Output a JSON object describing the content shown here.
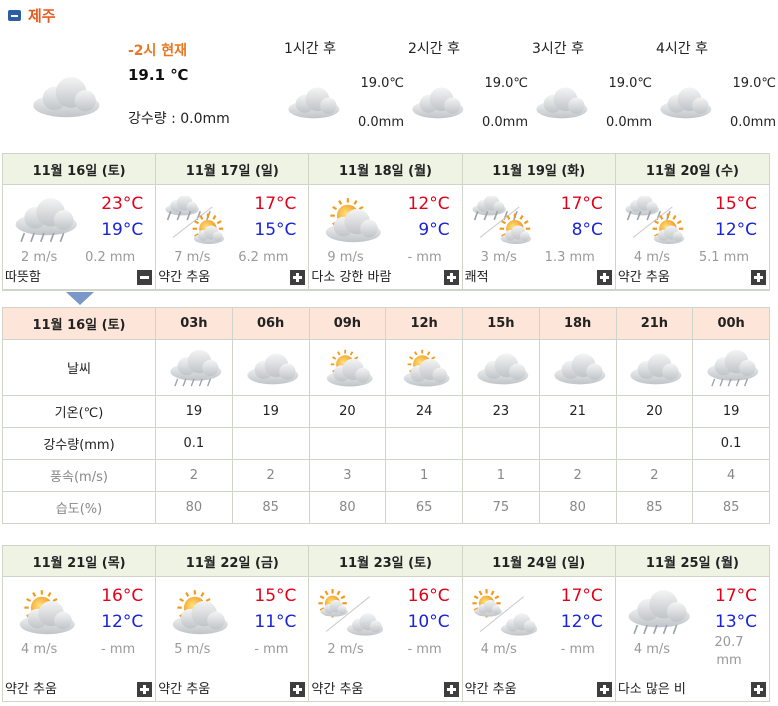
{
  "header": {
    "region": "제주"
  },
  "now": {
    "label": "-2시 현재",
    "temp": "19.1 ℃",
    "precip": "강수량 : 0.0mm",
    "icon": "cloudy-icon"
  },
  "hourly_forecast": [
    {
      "label": "1시간 후",
      "temp": "19.0℃",
      "precip": "0.0mm",
      "icon": "cloudy-icon"
    },
    {
      "label": "2시간 후",
      "temp": "19.0℃",
      "precip": "0.0mm",
      "icon": "cloudy-icon"
    },
    {
      "label": "3시간 후",
      "temp": "19.0℃",
      "precip": "0.0mm",
      "icon": "cloudy-icon"
    },
    {
      "label": "4시간 후",
      "temp": "19.0℃",
      "precip": "0.0mm",
      "icon": "cloudy-icon"
    }
  ],
  "week1": [
    {
      "date": "11월 16일 (토)",
      "hi": "23°C",
      "lo": "19°C",
      "wind": "2 m/s",
      "precip": "0.2 mm",
      "desc": "따뜻함",
      "icon": "rain-cloud-icon",
      "toggle": "minus"
    },
    {
      "date": "11월 17일 (일)",
      "hi": "17°C",
      "lo": "15°C",
      "wind": "7 m/s",
      "precip": "6.2 mm",
      "desc": "약간 추움",
      "icon": "rain-then-sun-icon",
      "toggle": "plus"
    },
    {
      "date": "11월 18일 (월)",
      "hi": "12°C",
      "lo": "9°C",
      "wind": "9 m/s",
      "precip": "- mm",
      "desc": "다소 강한 바람",
      "icon": "sun-cloud-icon",
      "toggle": "plus"
    },
    {
      "date": "11월 19일 (화)",
      "hi": "17°C",
      "lo": "8°C",
      "wind": "3 m/s",
      "precip": "1.3 mm",
      "desc": "쾌적",
      "icon": "rain-then-sun-icon",
      "toggle": "plus"
    },
    {
      "date": "11월 20일 (수)",
      "hi": "15°C",
      "lo": "12°C",
      "wind": "4 m/s",
      "precip": "5.1 mm",
      "desc": "약간 추움",
      "icon": "rain-then-sun-icon",
      "toggle": "plus"
    }
  ],
  "hourly_table": {
    "head_date": "11월 16일 (토)",
    "hours": [
      "03h",
      "06h",
      "09h",
      "12h",
      "15h",
      "18h",
      "21h",
      "00h"
    ],
    "weather_label": "날씨",
    "icons": [
      "rain-cloud-icon",
      "cloudy-icon",
      "sun-cloud-icon",
      "sun-cloud-icon",
      "cloudy-icon",
      "cloudy-icon",
      "cloudy-icon",
      "rain-cloud-icon"
    ],
    "rows": [
      {
        "label": "기온(℃)",
        "values": [
          "19",
          "19",
          "20",
          "24",
          "23",
          "21",
          "20",
          "19"
        ],
        "grey": false
      },
      {
        "label": "강수량(mm)",
        "values": [
          "0.1",
          "",
          "",
          "",
          "",
          "",
          "",
          "0.1"
        ],
        "grey": false
      },
      {
        "label": "풍속(m/s)",
        "values": [
          "2",
          "2",
          "3",
          "1",
          "1",
          "2",
          "2",
          "4"
        ],
        "grey": true
      },
      {
        "label": "습도(%)",
        "values": [
          "80",
          "85",
          "80",
          "65",
          "75",
          "80",
          "85",
          "85"
        ],
        "grey": true
      }
    ]
  },
  "week2": [
    {
      "date": "11월 21일 (목)",
      "hi": "16°C",
      "lo": "12°C",
      "wind": "4 m/s",
      "precip": "- mm",
      "desc": "약간 추움",
      "icon": "sun-cloud-icon",
      "toggle": "plus"
    },
    {
      "date": "11월 22일 (금)",
      "hi": "15°C",
      "lo": "11°C",
      "wind": "5 m/s",
      "precip": "- mm",
      "desc": "약간 추움",
      "icon": "sun-cloud-icon",
      "toggle": "plus"
    },
    {
      "date": "11월 23일 (토)",
      "hi": "16°C",
      "lo": "10°C",
      "wind": "2 m/s",
      "precip": "- mm",
      "desc": "약간 추움",
      "icon": "sun-then-cloud-icon",
      "toggle": "plus"
    },
    {
      "date": "11월 24일 (일)",
      "hi": "17°C",
      "lo": "12°C",
      "wind": "4 m/s",
      "precip": "- mm",
      "desc": "약간 추움",
      "icon": "sun-then-cloud-icon",
      "toggle": "plus"
    },
    {
      "date": "11월 25일 (월)",
      "hi": "17°C",
      "lo": "13°C",
      "wind": "4 m/s",
      "precip": "20.7 mm",
      "desc": "다소 많은 비",
      "icon": "rain-cloud-icon",
      "toggle": "plus"
    }
  ],
  "colors": {
    "hi": "#e3001b",
    "lo": "#1a24d6",
    "region": "#e85b1e",
    "now_label": "#e87722"
  }
}
